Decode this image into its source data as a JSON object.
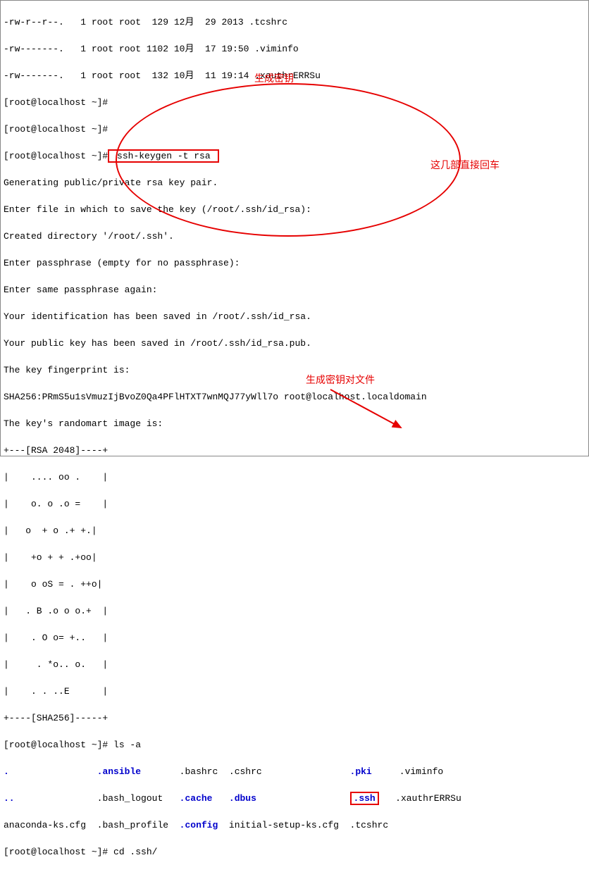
{
  "header": {
    "line1": "-rw-r--r--.   1 root root  129 12月  29 2013 .tcshrc",
    "line2": "-rw-------.   1 root root 1102 10月  17 19:50 .viminfo",
    "line3": "-rw-------.   1 root root  132 10月  11 19:14 .xauthrERRSu"
  },
  "prompts": {
    "empty1": "[root@localhost ~]#",
    "empty2": "[root@localhost ~]#",
    "keygen_prompt": "[root@localhost ~]#",
    "keygen_cmd": " ssh-keygen -t rsa ",
    "ls_prompt": "[root@localhost ~]# ls -a",
    "cd_prompt": "[root@localhost ~]# cd .ssh/"
  },
  "keygen_output": {
    "l1": "Generating public/private rsa key pair.",
    "l2": "Enter file in which to save the key (/root/.ssh/id_rsa):",
    "l3": "Created directory '/root/.ssh'.",
    "l4": "Enter passphrase (empty for no passphrase):",
    "l5": "Enter same passphrase again:",
    "l6": "Your identification has been saved in /root/.ssh/id_rsa.",
    "l7": "Your public key has been saved in /root/.ssh/id_rsa.pub.",
    "l8": "The key fingerprint is:",
    "l9": "SHA256:PRmS5u1sVmuzIjBvoZ0Qa4PFlHTXT7wnMQJ77yWll7o root@localhost.localdomain",
    "l10": "The key's randomart image is:"
  },
  "randomart": {
    "r1": "+---[RSA 2048]----+",
    "r2": "|    .... oo .    |",
    "r3": "|    o. o .o =    |",
    "r4": "|   o  + o .+ +.|",
    "r5": "|    +o + + .+oo|",
    "r6": "|    o oS = . ++o|",
    "r7": "|   . B .o o o.+  |",
    "r8": "|    . O o= +..   |",
    "r9": "|     . *o.. o.   |",
    "r10": "|    . . ..E      |",
    "r11": "+----[SHA256]-----+"
  },
  "ls_output": {
    "row1": {
      "c1": ".",
      "c2": ".ansible",
      "c3": ".bashrc",
      "c4": ".cshrc",
      "c5": ".pki",
      "c6": ".viminfo"
    },
    "row2": {
      "c1": "..",
      "c2": ".bash_logout",
      "c3": ".cache",
      "c4": ".dbus",
      "c5": ".ssh",
      "c6": ".xauthrERRSu"
    },
    "row3": {
      "c1": "anaconda-ks.cfg",
      "c2": ".bash_profile",
      "c3": ".config",
      "c4": "initial-setup-ks.cfg",
      "c5": ".tcshrc"
    }
  },
  "annotations": {
    "gen_key": "生成密钥",
    "press_enter": "这几部直接回车",
    "key_files": "生成密钥对文件"
  }
}
